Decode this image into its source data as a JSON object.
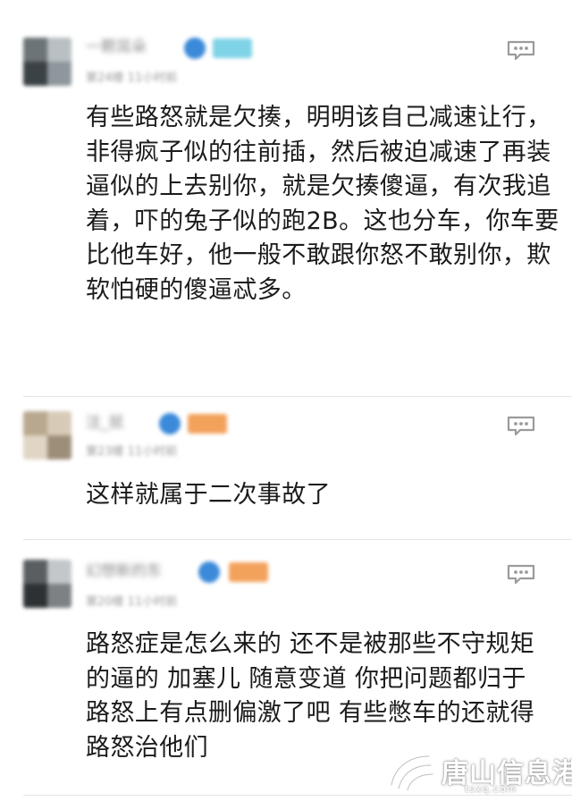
{
  "comments": [
    {
      "username": "一颗耳朵",
      "meta": "第24楼  11小时前",
      "text": "有些路怒就是欠揍，明明该自己减速让行，非得疯子似的往前插，然后被迫减速了再装逼似的上去别你，就是欠揍傻逼，有次我追着，吓的兔子似的跑2B。这也分车，你车要比他车好，他一般不敢跟你怒不敢别你，欺软怕硬的傻逼忒多。",
      "menu_icon": "more-options-icon"
    },
    {
      "username": "注_就",
      "meta": "第23楼  11小时前",
      "text": "这样就属于二次事故了",
      "menu_icon": "more-options-icon"
    },
    {
      "username": "幻想新的东",
      "meta": "第20楼  11小时前",
      "text": "路怒症是怎么来的 还不是被那些不守规矩的逼的 加塞儿 随意变道 你把问题都归于路怒上有点删偏激了吧 有些憋车的还就得路怒治他们",
      "menu_icon": "more-options-icon"
    }
  ],
  "watermark": {
    "text": "唐山信息港",
    "url": "tsxq.com"
  },
  "colors": {
    "vip_blue": "#3b8ad9",
    "level_cyan": "#7fd3e6",
    "level_orange": "#f3a25c",
    "divider": "#e4e4e4",
    "text": "#1b1b1b"
  }
}
